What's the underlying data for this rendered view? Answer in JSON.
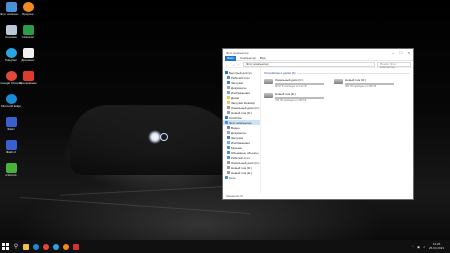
{
  "desktop": {
    "icons": [
      {
        "label": "Этот компьютер",
        "icon": "computer-icon",
        "color": "#4a90d9"
      },
      {
        "label": "Корзина",
        "icon": "recycle-bin-icon",
        "color": "#b9c9d8"
      },
      {
        "label": "Telegram",
        "icon": "telegram-icon",
        "color": "#2aa3e0"
      },
      {
        "label": "Google Chrome",
        "icon": "chrome-icon",
        "color": "#e2493a"
      },
      {
        "label": "Microsoft Edge",
        "icon": "edge-icon",
        "color": "#1b8bd6"
      },
      {
        "label": "Файл",
        "icon": "floppy-icon",
        "color": "#3a5fcf"
      },
      {
        "label": "Файл 2",
        "icon": "floppy-icon",
        "color": "#3a5fcf"
      },
      {
        "label": "uTorrent",
        "icon": "utorrent-icon",
        "color": "#48b33a"
      },
      {
        "label": "Браузер",
        "icon": "avatar-icon",
        "color": "#f08a1c"
      },
      {
        "label": "CCleaner",
        "icon": "ccleaner-icon",
        "color": "#2a9d4a"
      },
      {
        "label": "Документ",
        "icon": "document-icon",
        "color": "#f0f0f0"
      },
      {
        "label": "Приложение",
        "icon": "app-icon",
        "color": "#e03a2f"
      }
    ]
  },
  "explorer": {
    "title": "Этот компьютер",
    "ribbon_tabs": {
      "file": "Файл",
      "computer": "Компьютер",
      "view": "Вид"
    },
    "address": "Этот компьютер",
    "search_placeholder": "Поиск: Этот компьютер",
    "nav": [
      {
        "label": "Быстрый доступ",
        "level": 0,
        "color": "#1e6fd9"
      },
      {
        "label": "Рабочий стол",
        "level": 1,
        "color": "#4a90d9"
      },
      {
        "label": "Загрузки",
        "level": 1,
        "color": "#3a7fd0"
      },
      {
        "label": "Документы",
        "level": 1,
        "color": "#9aa5b5"
      },
      {
        "label": "Изображения",
        "level": 1,
        "color": "#6fa8dc"
      },
      {
        "label": "Диски",
        "level": 1,
        "color": "#e8c45a"
      },
      {
        "label": "Загрузки Desktop",
        "level": 1,
        "color": "#e8c45a"
      },
      {
        "label": "Локальный диск (C:)",
        "level": 1,
        "color": "#9a9a9a"
      },
      {
        "label": "Новый том (D:)",
        "level": 1,
        "color": "#9a9a9a"
      },
      {
        "label": "OneDrive",
        "level": 0,
        "color": "#2a7ad5"
      },
      {
        "label": "Этот компьютер",
        "level": 0,
        "color": "#4a90d9",
        "active": true
      },
      {
        "label": "Видео",
        "level": 1,
        "color": "#6f7fb5"
      },
      {
        "label": "Документы",
        "level": 1,
        "color": "#9aa5b5"
      },
      {
        "label": "Загрузки",
        "level": 1,
        "color": "#3a7fd0"
      },
      {
        "label": "Изображения",
        "level": 1,
        "color": "#6fa8dc"
      },
      {
        "label": "Музыка",
        "level": 1,
        "color": "#4a90d9"
      },
      {
        "label": "Объемные объекты",
        "level": 1,
        "color": "#4a90d9"
      },
      {
        "label": "Рабочий стол",
        "level": 1,
        "color": "#4a90d9"
      },
      {
        "label": "Локальный диск (C:)",
        "level": 1,
        "color": "#9a9a9a"
      },
      {
        "label": "Новый том (D:)",
        "level": 1,
        "color": "#9a9a9a"
      },
      {
        "label": "Новый том (E:)",
        "level": 1,
        "color": "#9a9a9a"
      },
      {
        "label": "Сеть",
        "level": 0,
        "color": "#4a90d9"
      }
    ],
    "section_title": "Устройства и диски (3)",
    "drives": [
      {
        "name": "Локальный диск (C:)",
        "free": "38,9 ГБ свободно из 111 ГБ",
        "used_fraction": 0.65
      },
      {
        "name": "Новый том (D:)",
        "free": "380 ГБ свободно из 465 ГБ",
        "used_fraction": 0.18
      },
      {
        "name": "Новый том (E:)",
        "free": "345 ГБ свободно из 465 ГБ",
        "used_fraction": 0.26
      }
    ],
    "status": "Элементов: 10"
  },
  "taskbar": {
    "apps": [
      {
        "icon": "file-explorer-icon",
        "color": "#f2c24a"
      },
      {
        "icon": "edge-icon",
        "color": "#1b8bd6"
      },
      {
        "icon": "chrome-icon",
        "color": "#e2493a"
      },
      {
        "icon": "telegram-icon",
        "color": "#2aa3e0"
      },
      {
        "icon": "avatar-icon",
        "color": "#f08a1c"
      },
      {
        "icon": "store-icon",
        "color": "#d1342f"
      }
    ],
    "time": "13:25",
    "date": "25.03.2023"
  }
}
